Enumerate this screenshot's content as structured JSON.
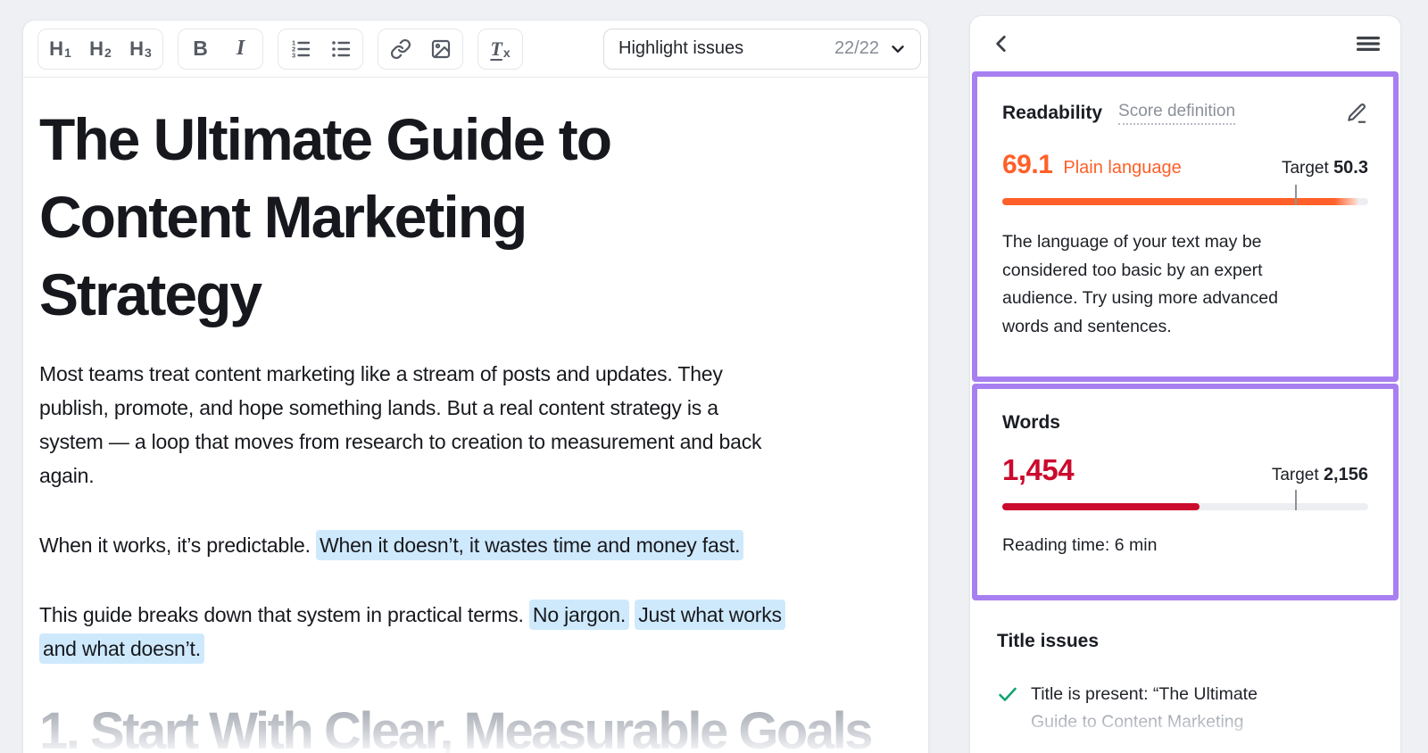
{
  "editor": {
    "toolbar": {
      "h1": {
        "label": "H",
        "sub": "1"
      },
      "h2": {
        "label": "H",
        "sub": "2"
      },
      "h3": {
        "label": "H",
        "sub": "3"
      },
      "bold": "B",
      "italic": "I",
      "clear_format": {
        "label": "T",
        "sub": "x"
      },
      "highlight_issues": {
        "label": "Highlight issues",
        "count": "22/22"
      }
    },
    "doc": {
      "title_lines": [
        "The Ultimate Guide to",
        "Content Marketing",
        "Strategy"
      ],
      "p1_lines": [
        "Most teams treat content marketing like a stream of posts and updates. They",
        "publish, promote, and hope something lands. But a real content strategy is a",
        "system — a loop that moves from research to creation to measurement and back",
        "again."
      ],
      "p2": {
        "plain": "When it works, it’s predictable. ",
        "highlight": "When it doesn’t, it wastes time and money fast."
      },
      "p3": {
        "line1": {
          "plain": "This guide breaks down that system in practical terms. ",
          "hl1": "No jargon.",
          "sep": " ",
          "hl2": "Just what works"
        },
        "line2": {
          "hl": "and what doesn’t."
        }
      },
      "faded_heading": "1. Start With Clear, Measurable Goals"
    }
  },
  "panel": {
    "readability": {
      "title": "Readability",
      "link": "Score definition",
      "score": "69.1",
      "score_label": "Plain language",
      "target_label": "Target",
      "target_value": "50.3",
      "bar": {
        "fill_pct": 97,
        "target_pct": 80,
        "color": "#ff5f28"
      },
      "description_lines": [
        "The language of your text may be",
        "considered too basic by an expert",
        "audience. Try using more advanced",
        "words and sentences."
      ]
    },
    "words": {
      "title": "Words",
      "count": "1,454",
      "target_label": "Target",
      "target_value": "2,156",
      "bar": {
        "fill_pct": 54,
        "target_pct": 80,
        "color": "#cb0a2d"
      },
      "reading_time": "Reading time: 6 min"
    },
    "title_issues": {
      "title": "Title issues",
      "items": [
        {
          "status": "pass",
          "line1": "Title is present: “The Ultimate",
          "line2": "Guide to Content Marketing"
        }
      ]
    }
  },
  "colors": {
    "accent_purple": "#a87ff0",
    "highlight_blue": "#cfe9fc",
    "score_orange": "#ff5f28",
    "words_red": "#cb0a2d",
    "check_green": "#13a373"
  }
}
